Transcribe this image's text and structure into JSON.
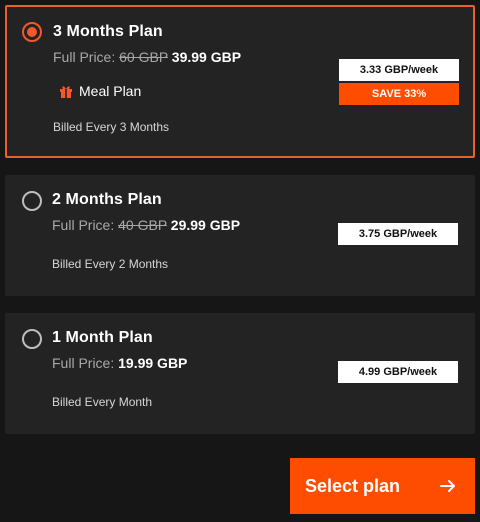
{
  "plans": [
    {
      "title": "3 Months Plan",
      "price_prefix": "Full Price: ",
      "old_price": "60 GBP",
      "new_price": "39.99 GBP",
      "perk": "Meal Plan",
      "billing": "Billed Every 3 Months",
      "weekly": "3.33 GBP/week",
      "save": "SAVE 33%",
      "selected": true
    },
    {
      "title": "2 Months Plan",
      "price_prefix": "Full Price: ",
      "old_price": "40 GBP",
      "new_price": "29.99 GBP",
      "billing": "Billed Every 2 Months",
      "weekly": "3.75 GBP/week",
      "selected": false
    },
    {
      "title": "1 Month Plan",
      "price_prefix": "Full Price: ",
      "new_price": "19.99 GBP",
      "billing": "Billed Every Month",
      "weekly": "4.99 GBP/week",
      "selected": false
    }
  ],
  "cta": {
    "label": "Select plan",
    "icon": "arrow-right-icon"
  },
  "colors": {
    "background": "#161616",
    "card": "#232323",
    "accent": "#ff4d00",
    "selected_border": "#e9602c",
    "badge_bg": "#ffffff"
  },
  "icons": {
    "perk_icon": "gift-icon",
    "radio_selected": "radio-selected-icon",
    "radio_unselected": "radio-unselected-icon"
  }
}
